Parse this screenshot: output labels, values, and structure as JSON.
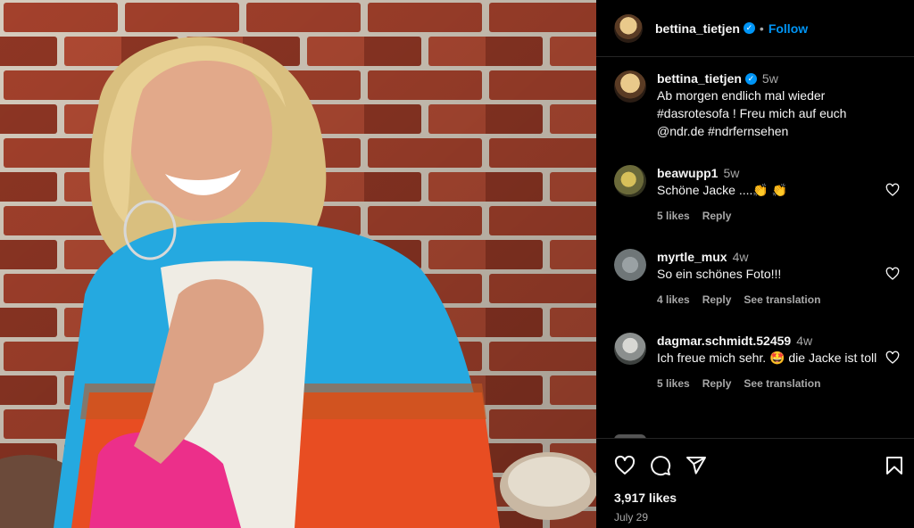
{
  "post": {
    "author": "bettina_tietjen",
    "follow_label": "Follow",
    "separator": "•",
    "likes": "3,917 likes",
    "date": "July 29"
  },
  "caption": {
    "username": "bettina_tietjen",
    "time": "5w",
    "text": "Ab morgen endlich mal wieder #dasrotesofa ! Freu mich auf euch @ndr.de #ndrfernsehen"
  },
  "comments": [
    {
      "username": "beawupp1",
      "time": "5w",
      "text": "Schöne Jacke ....👏 👏",
      "likes": "5 likes",
      "reply": "Reply"
    },
    {
      "username": "myrtle_mux",
      "time": "4w",
      "text": "So ein schönes Foto!!!",
      "likes": "4 likes",
      "reply": "Reply",
      "translate": "See translation"
    },
    {
      "username": "dagmar.schmidt.52459",
      "time": "4w",
      "text": "Ich freue mich sehr. 🤩 die Jacke ist toll",
      "likes": "5 likes",
      "reply": "Reply",
      "translate": "See translation"
    }
  ],
  "icons": {
    "like": "heart-icon",
    "comment": "comment-icon",
    "share": "share-icon",
    "save": "bookmark-icon",
    "verified": "verified-badge-icon"
  },
  "colors": {
    "background": "#000000",
    "link": "#0095f6",
    "muted": "#a8a8a8",
    "text": "#f5f5f5"
  }
}
